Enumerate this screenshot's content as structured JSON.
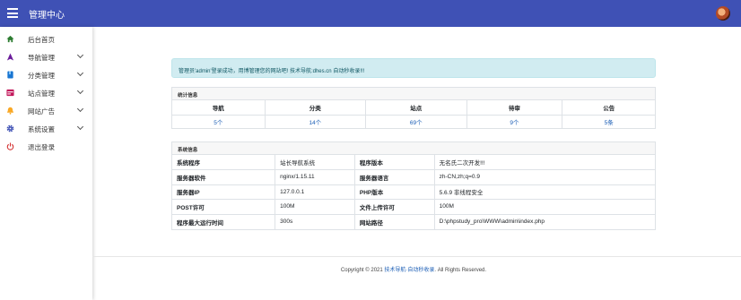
{
  "topbar": {
    "title": "管理中心"
  },
  "sidebar": {
    "items": [
      {
        "label": "后台首页",
        "icon": "home-icon",
        "color": "#2e7d32",
        "expandable": false
      },
      {
        "label": "导航管理",
        "icon": "navigation-icon",
        "color": "#6a1b9a",
        "expandable": true
      },
      {
        "label": "分类管理",
        "icon": "book-icon",
        "color": "#1976d2",
        "expandable": true
      },
      {
        "label": "站点管理",
        "icon": "site-icon",
        "color": "#c2185b",
        "expandable": true
      },
      {
        "label": "网站广告",
        "icon": "bell-icon",
        "color": "#f9a825",
        "expandable": true
      },
      {
        "label": "系统设置",
        "icon": "gear-icon",
        "color": "#3f51b5",
        "expandable": true
      },
      {
        "label": "退出登录",
        "icon": "power-icon",
        "color": "#d32f2f",
        "expandable": false
      }
    ]
  },
  "alert": {
    "text": "管理员'admin'登录成功，用博管理您的网站吧! 技术导航:dhes.cn 自动秒收录!!!"
  },
  "stats": {
    "title": "统计信息",
    "headers": [
      "导航",
      "分类",
      "站点",
      "待审",
      "公告"
    ],
    "values": [
      "5个",
      "14个",
      "69个",
      "9个",
      "5条"
    ]
  },
  "system": {
    "title": "系统信息",
    "rows": [
      {
        "k1": "系统程序",
        "v1": "站长导航系统",
        "k2": "程序版本",
        "v2": "无名氏二次开发!!!"
      },
      {
        "k1": "服务器软件",
        "v1": "nginx/1.15.11",
        "k2": "服务器语言",
        "v2": "zh-CN,zh;q=0.9"
      },
      {
        "k1": "服务器IP",
        "v1": "127.0.0.1",
        "k2": "PHP版本",
        "v2": "5.6.9 非线程安全"
      },
      {
        "k1": "POST许可",
        "v1": "100M",
        "k2": "文件上传许可",
        "v2": "100M"
      },
      {
        "k1": "程序最大运行时间",
        "v1": "300s",
        "k2": "网站路径",
        "v2": "D:\\phpstudy_pro\\WWW\\admin\\index.php"
      }
    ]
  },
  "footer": {
    "prefix": "Copyright © 2021 ",
    "link": "技术导航·自动秒收录",
    "suffix": ". All Rights Reserved."
  }
}
